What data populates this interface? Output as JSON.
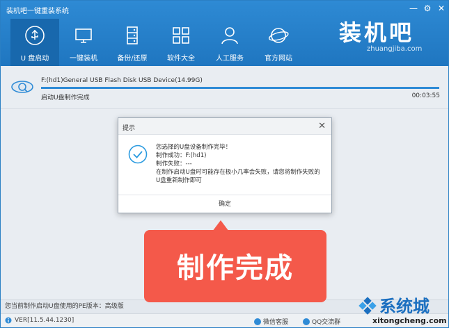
{
  "window": {
    "title": "装机吧一键重装系统"
  },
  "winctl": {
    "min": "—",
    "settings": "⚙",
    "close": "✕"
  },
  "nav": [
    {
      "label": "U 盘启动",
      "icon": "usb-icon"
    },
    {
      "label": "一键装机",
      "icon": "monitor-icon"
    },
    {
      "label": "备份/还原",
      "icon": "server-icon"
    },
    {
      "label": "软件大全",
      "icon": "grid-icon"
    },
    {
      "label": "人工服务",
      "icon": "user-icon"
    },
    {
      "label": "官方网站",
      "icon": "planet-icon"
    }
  ],
  "logo": {
    "text": "装机吧",
    "url": "zhuangjiba.com"
  },
  "device": {
    "name": "F:(hd1)General USB Flash Disk USB Device(14.99G)",
    "status": "启动U盘制作完成",
    "elapsed": "00:03:55",
    "progress": 1.0
  },
  "dialog": {
    "title": "提示",
    "lines": [
      "您选择的U盘设备制作完毕！",
      "制作成功：F:(hd1)",
      "制作失败：---",
      "在制作启动U盘时可能存在极小几率会失败，请您将制作失败的",
      "U盘重新制作即可"
    ],
    "ok": "确定"
  },
  "callout": {
    "text": "制作完成"
  },
  "pe_info": "您当前制作启动U盘使用的PE版本：高级版",
  "footer": {
    "version": "VER[11.5.44.1230]",
    "wechat": "微信客服",
    "qq": "QQ交流群"
  },
  "watermark": {
    "text": "系统城",
    "url": "xitongcheng.com"
  },
  "colors": {
    "header": "#2383cb",
    "accent": "#2f8bd6",
    "callout": "#f4594a",
    "success": "#2b9be0"
  }
}
